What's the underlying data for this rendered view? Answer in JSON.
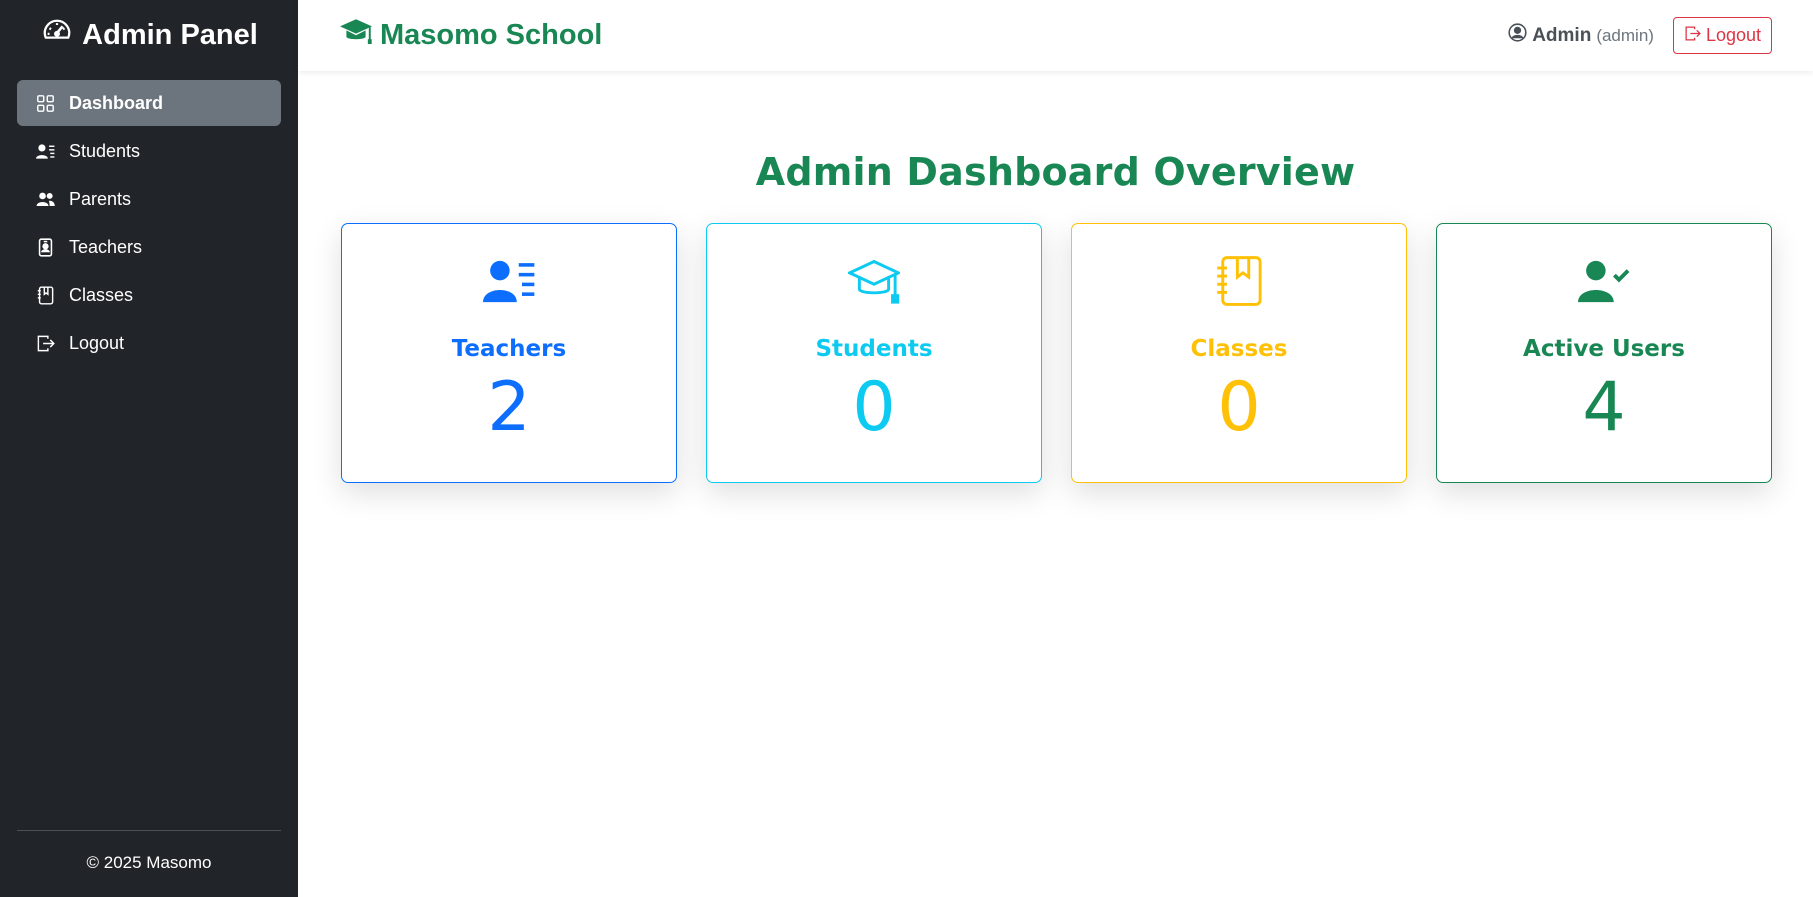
{
  "sidebar": {
    "title": "Admin Panel",
    "items": [
      {
        "label": "Dashboard",
        "icon": "grid-icon",
        "active": true
      },
      {
        "label": "Students",
        "icon": "person-lines-icon",
        "active": false
      },
      {
        "label": "Parents",
        "icon": "people-icon",
        "active": false
      },
      {
        "label": "Teachers",
        "icon": "person-badge-icon",
        "active": false
      },
      {
        "label": "Classes",
        "icon": "journal-bookmark-icon",
        "active": false
      },
      {
        "label": "Logout",
        "icon": "box-arrow-right-icon",
        "active": false
      }
    ],
    "footer": "© 2025 Masomo"
  },
  "header": {
    "brand": "Masomo School",
    "user_name": "Admin",
    "user_role": "(admin)",
    "logout_label": "Logout"
  },
  "main": {
    "title": "Admin Dashboard Overview",
    "cards": [
      {
        "label": "Teachers",
        "value": "2",
        "icon": "person-lines-icon",
        "color": "#0d6efd"
      },
      {
        "label": "Students",
        "value": "0",
        "icon": "mortarboard-icon",
        "color": "#0dcaf0"
      },
      {
        "label": "Classes",
        "value": "0",
        "icon": "journal-bookmark-icon",
        "color": "#ffc107"
      },
      {
        "label": "Active Users",
        "value": "4",
        "icon": "person-check-icon",
        "color": "#198754"
      }
    ]
  },
  "colors": {
    "sidebar_bg": "#212529",
    "active_item_bg": "#6c757d",
    "brand_green": "#198754",
    "logout_red": "#dc3545"
  }
}
